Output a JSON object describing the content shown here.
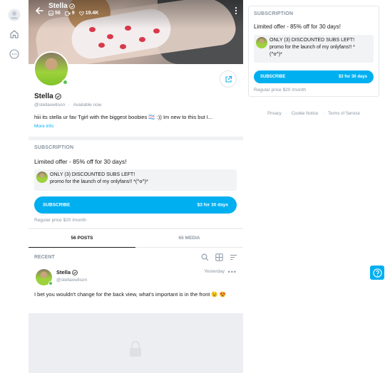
{
  "header": {
    "name": "Stella",
    "stats": {
      "photos": "56",
      "videos": "9",
      "likes": "19.4K"
    }
  },
  "profile": {
    "name": "Stella",
    "handle": "@stellaxwilson",
    "status": "Available now",
    "separator": "·",
    "bio": "hiii its stella ur fav Tgirl with the biggest boobies 🏳️‍⚧️ :)) Im new to this but I...",
    "more_info": "More info"
  },
  "subscription": {
    "section_title": "SUBSCRIPTION",
    "offer_title": "Limited offer - 85% off for 30 days!",
    "promo_line1": "ONLY (3) DISCOUNTED SUBS LEFT!",
    "promo_line2": "promo for the launch of my onlyfans!! *(^o^)*",
    "promo_right_line1": "ONLY (3) DISCOUNTED SUBS LEFT!",
    "promo_right_line2": "promo for the launch of my onlyfans!! *",
    "promo_right_line3": "(^o^)*",
    "subscribe_label": "SUBSCRIBE",
    "price_label": "$3 for 30 days",
    "regular_price": "Regular price $20 /month"
  },
  "tabs": [
    {
      "label": "56 POSTS",
      "active": true
    },
    {
      "label": "65 MEDIA",
      "active": false
    }
  ],
  "feed": {
    "section_title": "RECENT",
    "post": {
      "name": "Stella",
      "handle": "@stellaxwilson",
      "time": "Yesterday",
      "text": "I bet you wouldn't change for the back view, what's important is in the front 😉 😍"
    }
  },
  "footer": {
    "privacy": "Privacy",
    "cookie": "Cookie Notice",
    "terms": "Terms of Service",
    "dot": "·"
  },
  "colors": {
    "accent": "#00aff0",
    "muted": "#8a96a3",
    "online": "#5ac05a"
  }
}
